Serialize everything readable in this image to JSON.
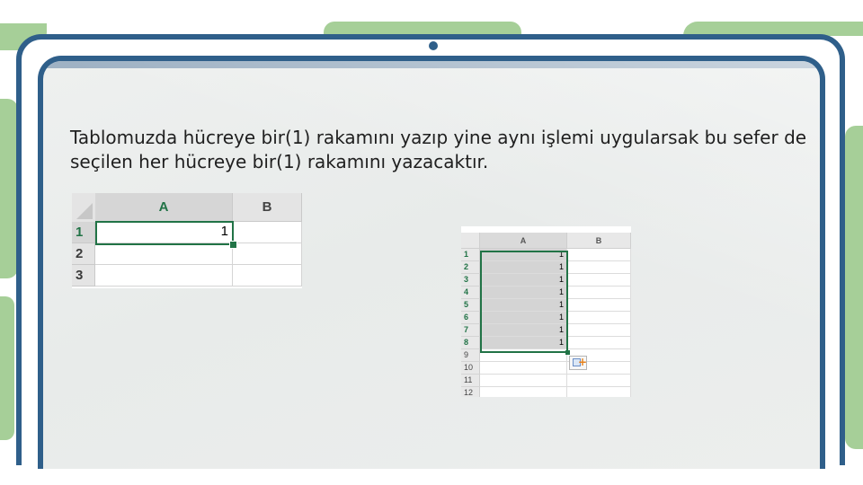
{
  "description": "Tablomuzda hücreye bir(1) rakamını yazıp yine aynı işlemi uygularsak bu sefer de seçilen her hücreye bir(1) rakamını yazacaktır.",
  "colors": {
    "frame": "#2f5f8a",
    "accent_green": "#a6cf98",
    "excel_green": "#217346"
  },
  "sheet_small": {
    "columns": [
      "A",
      "B"
    ],
    "rows": [
      {
        "header": "1",
        "a": "1",
        "b": ""
      },
      {
        "header": "2",
        "a": "",
        "b": ""
      },
      {
        "header": "3",
        "a": "",
        "b": ""
      }
    ]
  },
  "sheet_large": {
    "columns": [
      "A",
      "B"
    ],
    "rows": [
      {
        "header": "1",
        "a": "1"
      },
      {
        "header": "2",
        "a": "1"
      },
      {
        "header": "3",
        "a": "1"
      },
      {
        "header": "4",
        "a": "1"
      },
      {
        "header": "5",
        "a": "1"
      },
      {
        "header": "6",
        "a": "1"
      },
      {
        "header": "7",
        "a": "1"
      },
      {
        "header": "8",
        "a": "1"
      },
      {
        "header": "9",
        "a": ""
      },
      {
        "header": "10",
        "a": ""
      },
      {
        "header": "11",
        "a": ""
      },
      {
        "header": "12",
        "a": ""
      }
    ],
    "autofill_icon": "autofill-options-icon"
  }
}
